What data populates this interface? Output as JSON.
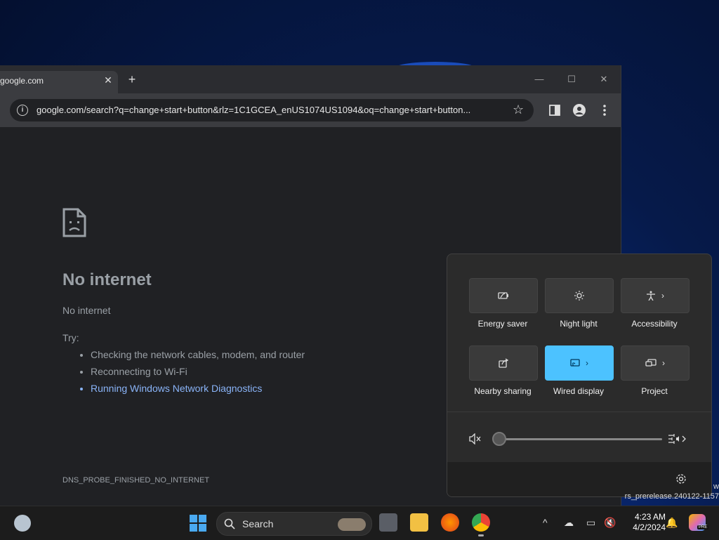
{
  "browser": {
    "tab_title": "google.com",
    "url": "google.com/search?q=change+start+button&rlz=1C1GCEA_enUS1074US1094&oq=change+start+button...",
    "error_title": "No internet",
    "error_subtitle": "No internet",
    "try_label": "Try:",
    "suggestions": [
      "Checking the network cables, modem, and router",
      "Reconnecting to Wi-Fi",
      "Running Windows Network Diagnostics"
    ],
    "error_code": "DNS_PROBE_FINISHED_NO_INTERNET"
  },
  "quick_settings": {
    "tiles": [
      {
        "label": "Energy saver",
        "icon": "energy-saver-icon",
        "active": false,
        "chevron": false
      },
      {
        "label": "Night light",
        "icon": "night-light-icon",
        "active": false,
        "chevron": false
      },
      {
        "label": "Accessibility",
        "icon": "accessibility-icon",
        "active": false,
        "chevron": true
      },
      {
        "label": "Nearby sharing",
        "icon": "nearby-sharing-icon",
        "active": false,
        "chevron": false
      },
      {
        "label": "Wired display",
        "icon": "wired-display-icon",
        "active": true,
        "chevron": true
      },
      {
        "label": "Project",
        "icon": "project-icon",
        "active": false,
        "chevron": true
      }
    ],
    "volume_level": 0,
    "volume_muted": true
  },
  "watermark": {
    "line1": "w",
    "line2": "rs_prerelease.240122-1157"
  },
  "taskbar": {
    "search_label": "Search",
    "time": "4:23 AM",
    "date": "4/2/2024",
    "copilot_badge": "PRE"
  },
  "colors": {
    "accent": "#4cc2ff",
    "link": "#8ab4f8",
    "start": "#4aa9f0"
  }
}
